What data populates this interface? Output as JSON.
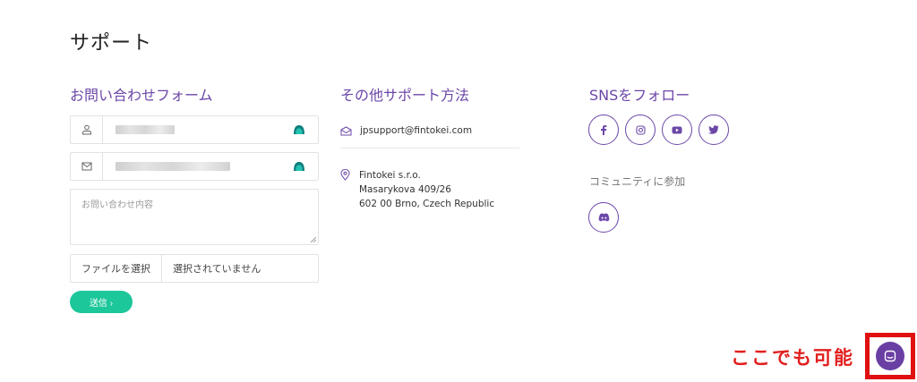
{
  "page": {
    "title": "サポート"
  },
  "contact_form": {
    "title": "お問い合わせフォーム",
    "message_placeholder": "お問い合わせ内容",
    "file_button_label": "ファイルを選択",
    "file_status": "選択されていません",
    "submit_label": "送信 ›"
  },
  "other_support": {
    "title": "その他サポート方法",
    "email": "jpsupport@fintokei.com",
    "address_lines": [
      "Fintokei s.r.o.",
      "Masarykova 409/26",
      "602 00 Brno, Czech Republic"
    ]
  },
  "sns": {
    "title": "SNSをフォロー",
    "icons": [
      "facebook-icon",
      "instagram-icon",
      "youtube-icon",
      "twitter-icon"
    ],
    "community_label": "コミュニティに参加",
    "community_icon": "discord-icon"
  },
  "annotation": {
    "text": "ここでも可能"
  },
  "colors": {
    "accent_purple": "#6b47a8",
    "send_green": "#1cc79a",
    "annotation_red": "#e21f1f",
    "launcher_purple": "#6a3fa3"
  }
}
